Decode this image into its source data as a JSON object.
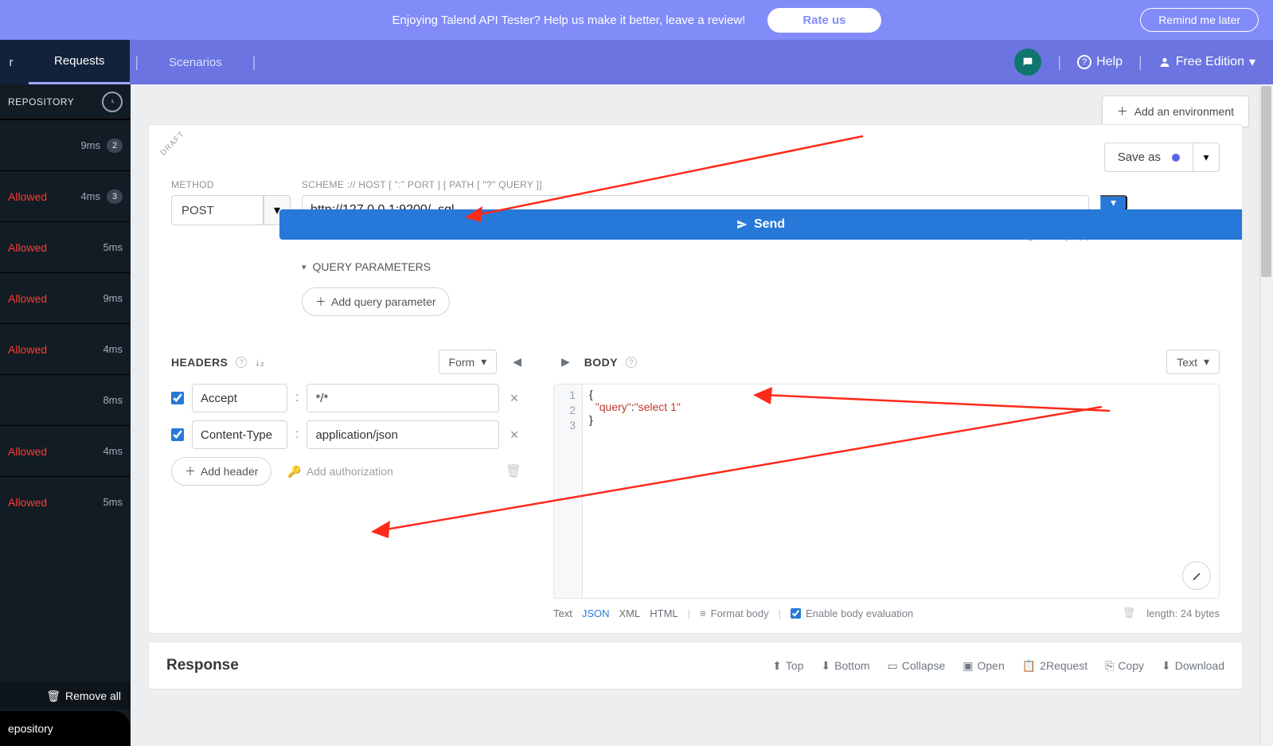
{
  "promo": {
    "text": "Enjoying Talend API Tester? Help us make it better, leave a review!",
    "rate": "Rate us",
    "remind": "Remind me later"
  },
  "nav": {
    "tab_left": "r",
    "tab_requests": "Requests",
    "tab_scenarios": "Scenarios",
    "help": "Help",
    "edition": "Free Edition"
  },
  "sidebar": {
    "title": "REPOSITORY",
    "items": [
      {
        "label": "",
        "ms": "9ms",
        "badge": "2"
      },
      {
        "label": "Allowed",
        "ms": "4ms",
        "badge": "3"
      },
      {
        "label": "Allowed",
        "ms": "5ms",
        "badge": ""
      },
      {
        "label": "Allowed",
        "ms": "9ms",
        "badge": ""
      },
      {
        "label": "Allowed",
        "ms": "4ms",
        "badge": ""
      },
      {
        "label": "",
        "ms": "8ms",
        "badge": ""
      },
      {
        "label": "Allowed",
        "ms": "4ms",
        "badge": ""
      },
      {
        "label": "Allowed",
        "ms": "5ms",
        "badge": ""
      }
    ],
    "remove_all": "Remove all",
    "bottom": "epository"
  },
  "env": {
    "add": "Add an environment"
  },
  "request": {
    "draft": "DRAFT",
    "save_as": "Save as",
    "method_label": "METHOD",
    "scheme_label": "SCHEME :// HOST [ \":\" PORT ] [ PATH [ \"?\" QUERY ]]",
    "method": "POST",
    "url": "http://127.0.0.1:9200/_sql",
    "url_meta": "length: 26 byte(s)",
    "send": "Send",
    "qp_title": "QUERY PARAMETERS",
    "add_qp": "Add query parameter"
  },
  "headers": {
    "title": "HEADERS",
    "form": "Form",
    "rows": [
      {
        "name": "Accept",
        "value": "*/*"
      },
      {
        "name": "Content-Type",
        "value": "application/json"
      }
    ],
    "add": "Add header",
    "auth": "Add authorization"
  },
  "body": {
    "title": "BODY",
    "mode": "Text",
    "code_l1": "{",
    "code_l2a": "\"query\"",
    "code_l2b": ":",
    "code_l2c": "\"select 1\"",
    "code_l3": "}",
    "foot_text": "Text",
    "foot_json": "JSON",
    "foot_xml": "XML",
    "foot_html": "HTML",
    "format_body": "Format body",
    "enable_eval": "Enable body evaluation",
    "length": "length: 24 bytes"
  },
  "response": {
    "title": "Response",
    "top": "Top",
    "bottom": "Bottom",
    "collapse": "Collapse",
    "open": "Open",
    "torequest": "2Request",
    "copy": "Copy",
    "download": "Download"
  }
}
